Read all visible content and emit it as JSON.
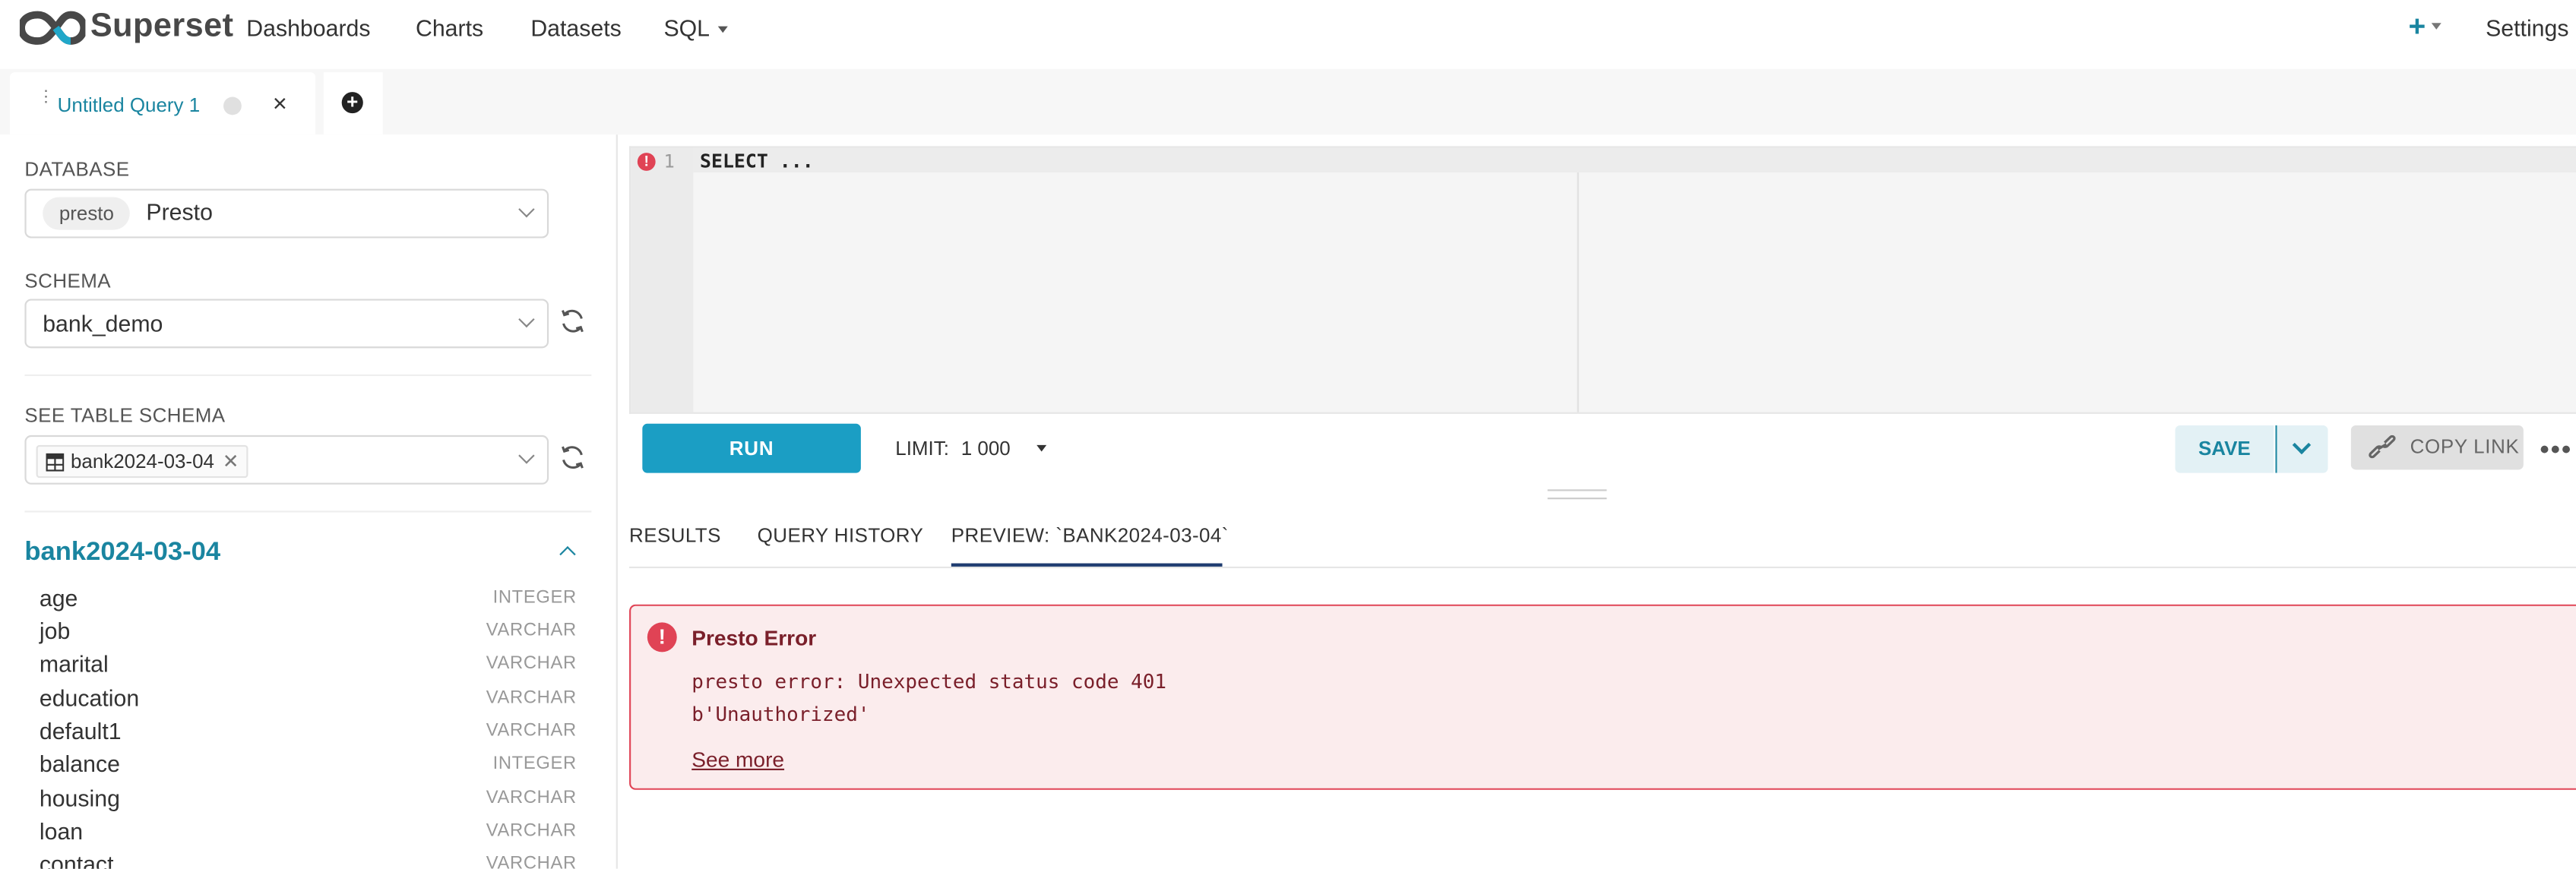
{
  "navbar": {
    "brand": "Superset",
    "items": [
      "Dashboards",
      "Charts",
      "Datasets",
      "SQL"
    ],
    "plus": "+",
    "settings": "Settings"
  },
  "tabs": {
    "query_tab_label": "Untitled Query 1",
    "close": "×",
    "add": "+"
  },
  "left": {
    "database_label": "DATABASE",
    "database_pill": "presto",
    "database_name": "Presto",
    "schema_label": "SCHEMA",
    "schema_value": "bank_demo",
    "table_schema_label": "SEE TABLE SCHEMA",
    "table_tag": "bank2024-03-04",
    "table_title": "bank2024-03-04",
    "columns": [
      {
        "name": "age",
        "type": "INTEGER"
      },
      {
        "name": "job",
        "type": "VARCHAR"
      },
      {
        "name": "marital",
        "type": "VARCHAR"
      },
      {
        "name": "education",
        "type": "VARCHAR"
      },
      {
        "name": "default1",
        "type": "VARCHAR"
      },
      {
        "name": "balance",
        "type": "INTEGER"
      },
      {
        "name": "housing",
        "type": "VARCHAR"
      },
      {
        "name": "loan",
        "type": "VARCHAR"
      },
      {
        "name": "contact",
        "type": "VARCHAR"
      }
    ]
  },
  "editor": {
    "line_number": "1",
    "code": "SELECT ..."
  },
  "toolbar": {
    "run": "RUN",
    "limit_label": "LIMIT:",
    "limit_value": "1 000",
    "save": "SAVE",
    "copy_link": "COPY LINK",
    "more": "•••"
  },
  "results_tabs": {
    "results": "RESULTS",
    "query_history": "QUERY HISTORY",
    "preview": "PREVIEW: `BANK2024-03-04`"
  },
  "error": {
    "title": "Presto Error",
    "message_line1": "presto error: Unexpected status code 401",
    "message_line2": "b'Unauthorized'",
    "see_more": "See more"
  },
  "colors": {
    "brand": "#1a85a0",
    "run_button": "#1b9ec4",
    "error_border": "#e04355",
    "error_bg": "#fbeced",
    "error_text": "#7a1f2a",
    "active_tab_underline": "#1f3c70"
  }
}
